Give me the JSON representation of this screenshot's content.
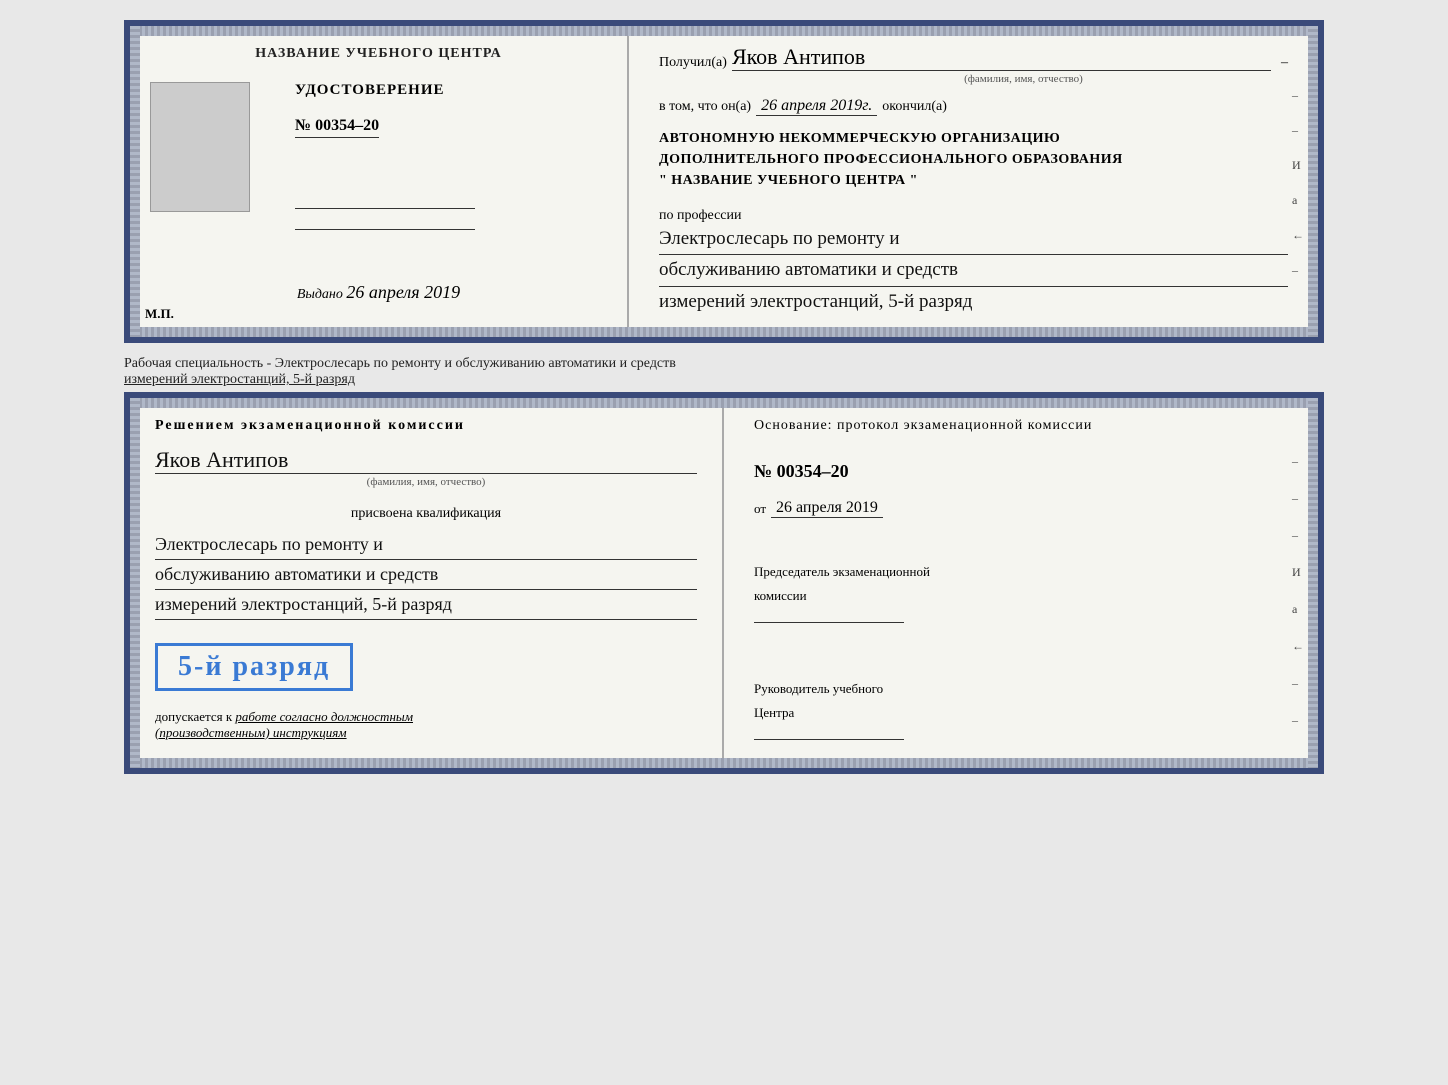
{
  "topDoc": {
    "left": {
      "headerLabel": "НАЗВАНИЕ УЧЕБНОГО ЦЕНТРА",
      "certTitle": "УДОСТОВЕРЕНИЕ",
      "certNumber": "№ 00354–20",
      "issuedLabel": "Выдано",
      "issuedDate": "26 апреля 2019",
      "mpLabel": "М.П."
    },
    "right": {
      "recipientLabel": "Получил(а)",
      "recipientName": "Яков Антипов",
      "recipientSubtitle": "(фамилия, имя, отчество)",
      "dateLine1": "в том, что он(а)",
      "date": "26 апреля 2019г.",
      "dateEnd": "окончил(а)",
      "orgLine1": "АВТОНОМНУЮ НЕКОММЕРЧЕСКУЮ ОРГАНИЗАЦИЮ",
      "orgLine2": "ДОПОЛНИТЕЛЬНОГО ПРОФЕССИОНАЛЬНОГО ОБРАЗОВАНИЯ",
      "orgLine3": "\"    НАЗВАНИЕ УЧЕБНОГО ЦЕНТРА    \"",
      "professionLabel": "по профессии",
      "professionLine1": "Электрослесарь по ремонту и",
      "professionLine2": "обслуживанию автоматики и средств",
      "professionLine3": "измерений электростанций, 5-й разряд",
      "sideLabels": [
        "–",
        "–",
        "И",
        "а",
        "←",
        "–"
      ]
    }
  },
  "specialtyText": "Рабочая специальность - Электрослесарь по ремонту и обслуживанию автоматики и средств",
  "specialtyText2": "измерений электростанций, 5-й разряд",
  "bottomDoc": {
    "left": {
      "decisionTitle": "Решением  экзаменационной  комиссии",
      "name": "Яков Антипов",
      "nameSubtitle": "(фамилия, имя, отчество)",
      "qualLabel": "присвоена квалификация",
      "qualLine1": "Электрослесарь по ремонту и",
      "qualLine2": "обслуживанию автоматики и средств",
      "qualLine3": "измерений электростанций, 5-й разряд",
      "rankBadge": "5-й разряд",
      "allowedText": "допускается к",
      "allowedItalic": "работе согласно должностным",
      "allowedItalic2": "(производственным) инструкциям"
    },
    "right": {
      "basisTitle": "Основание:  протокол  экзаменационной  комиссии",
      "protocolNumber": "№  00354–20",
      "dateLabel": "от",
      "date": "26 апреля 2019",
      "chairmanLabel": "Председатель экзаменационной",
      "chairmanLabel2": "комиссии",
      "headLabel": "Руководитель учебного",
      "headLabel2": "Центра",
      "sideLabels": [
        "–",
        "–",
        "–",
        "И",
        "а",
        "←",
        "–",
        "–",
        "–"
      ]
    }
  }
}
